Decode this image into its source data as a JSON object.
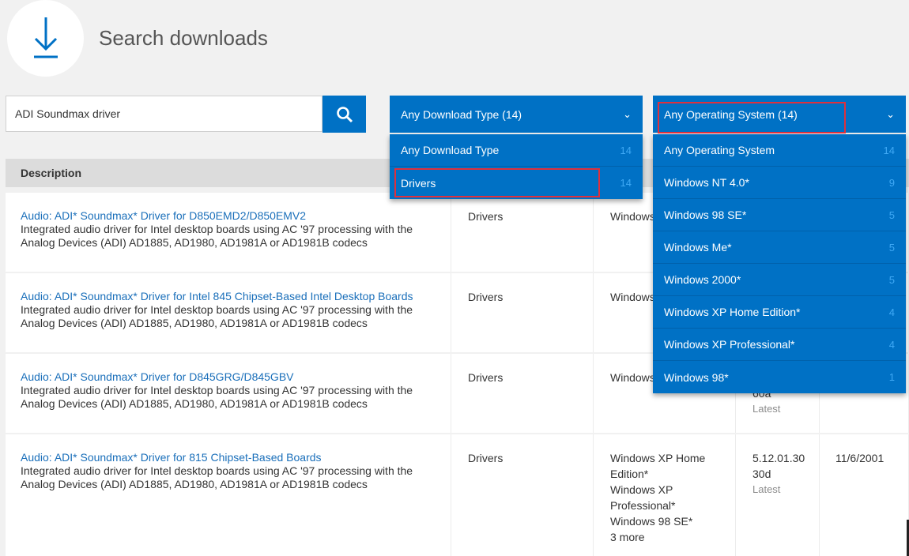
{
  "header": {
    "title": "Search downloads"
  },
  "search": {
    "value": "ADI Soundmax driver"
  },
  "filters": {
    "type_label": "Any Download Type (14)",
    "os_label": "Any Operating System (14)"
  },
  "type_menu": [
    {
      "label": "Any Download Type",
      "count": "14"
    },
    {
      "label": "Drivers",
      "count": "14"
    }
  ],
  "os_menu": [
    {
      "label": "Any Operating System",
      "count": "14"
    },
    {
      "label": "Windows NT 4.0*",
      "count": "9"
    },
    {
      "label": "Windows 98 SE*",
      "count": "5"
    },
    {
      "label": "Windows Me*",
      "count": "5"
    },
    {
      "label": "Windows 2000*",
      "count": "5"
    },
    {
      "label": "Windows XP Home Edition*",
      "count": "4"
    },
    {
      "label": "Windows XP Professional*",
      "count": "4"
    },
    {
      "label": "Windows 98*",
      "count": "1"
    }
  ],
  "table": {
    "header_description": "Description",
    "rows": [
      {
        "title": "Audio: ADI* Soundmax* Driver for D850EMD2/D850EMV2",
        "desc": "Integrated audio driver for Intel desktop boards using AC '97 processing with the Analog Devices (ADI) AD1885, AD1980, AD1981A or AD1981B codecs",
        "type": "Drivers",
        "os": "Windows"
      },
      {
        "title": "Audio: ADI* Soundmax* Driver for Intel 845 Chipset-Based Intel Desktop Boards",
        "desc": "Integrated audio driver for Intel desktop boards using AC '97 processing with the Analog Devices (ADI) AD1885, AD1980, AD1981A or AD1981B codecs",
        "type": "Drivers",
        "os": "Windows"
      },
      {
        "title": "Audio: ADI* Soundmax* Driver for D845GRG/D845GBV",
        "desc": "Integrated audio driver for Intel desktop boards using AC '97 processing with the Analog Devices (ADI) AD1885, AD1980, AD1981A or AD1981B codecs",
        "type": "Drivers",
        "os": "Windows",
        "version_tail": "60a",
        "status": "Latest"
      },
      {
        "title": "Audio: ADI* Soundmax* Driver for 815 Chipset-Based Boards",
        "desc": "Integrated audio driver for Intel desktop boards using AC '97 processing with the Analog Devices (ADI) AD1885, AD1980, AD1981A or AD1981B codecs",
        "type": "Drivers",
        "os_lines": [
          "Windows XP Home",
          "Edition*",
          "Windows XP",
          "Professional*",
          "Windows 98 SE*",
          "3 more"
        ],
        "version_lines": [
          "5.12.01.30",
          "30d"
        ],
        "status": "Latest",
        "date": "11/6/2001"
      }
    ]
  }
}
